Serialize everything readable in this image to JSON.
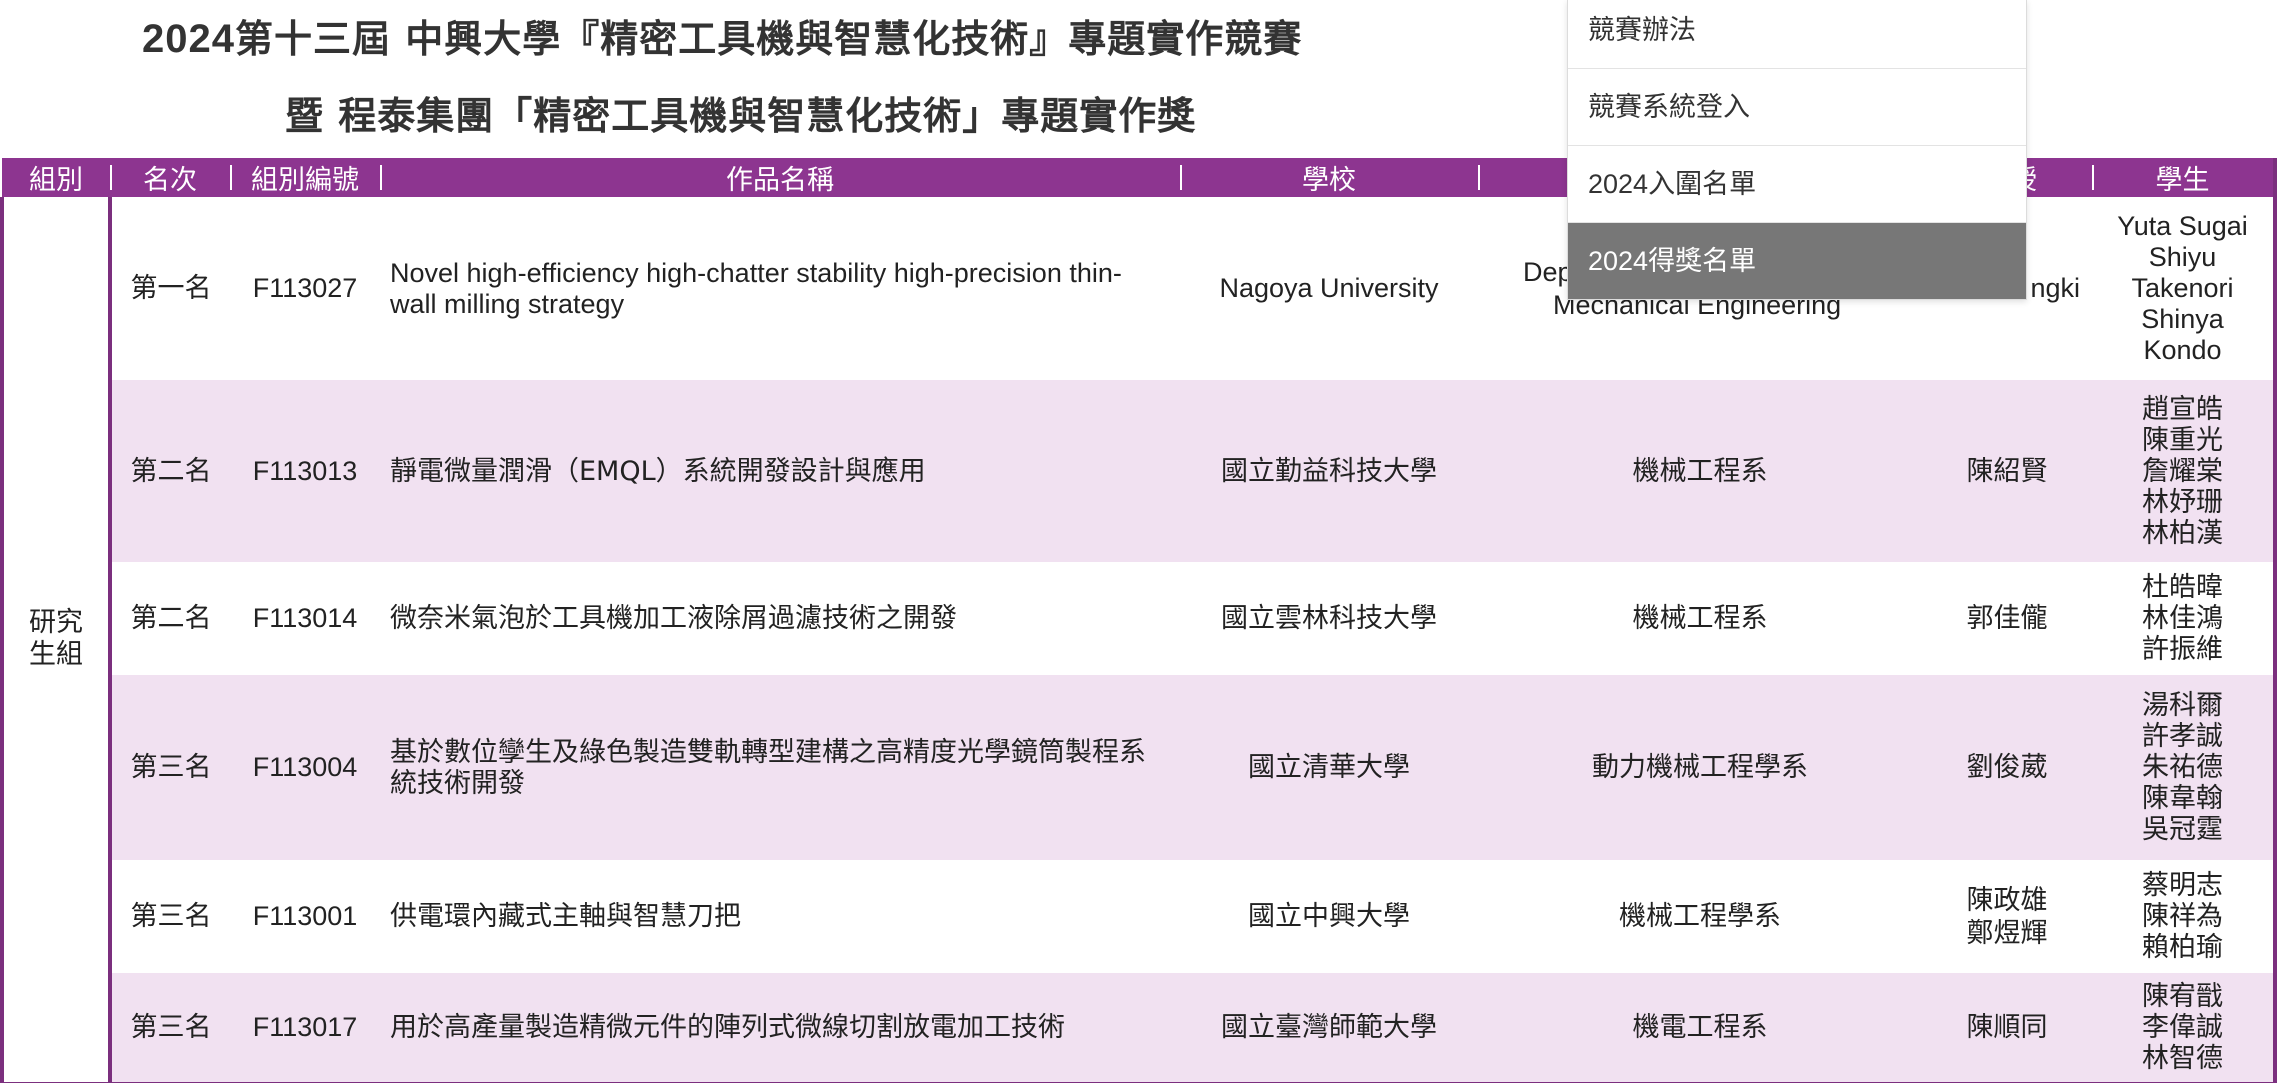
{
  "header": {
    "title_year": "2024",
    "title_line1": "第十三屆 中興大學『精密工具機與智慧化技術』專題實作競賽",
    "title_line2": "暨 程泰集團「精密工具機與智慧化技術」專題實作獎"
  },
  "dropdown": {
    "items": [
      {
        "label": "競賽辦法"
      },
      {
        "label": "競賽系統登入"
      },
      {
        "label": "2024入圍名單"
      },
      {
        "label": "2024得獎名單",
        "active": true
      }
    ]
  },
  "table": {
    "columns": [
      "組別",
      "名次",
      "組別編號",
      "作品名稱",
      "學校",
      "",
      "授",
      "學生"
    ],
    "group_label": "研究生組",
    "rows": [
      {
        "rank": "第一名",
        "code": "F113027",
        "title": "Novel high-efficiency high-chatter stability high-precision thin-wall milling strategy",
        "school": "Nagoya University",
        "department": "Mechanical Engineering",
        "department_partial": "Depar",
        "advisor": "ngki",
        "students": [
          "Yuta Sugai",
          "Shiyu",
          "Takenori",
          "Shinya",
          "Kondo"
        ]
      },
      {
        "rank": "第二名",
        "code": "F113013",
        "title": "靜電微量潤滑（EMQL）系統開發設計與應用",
        "school": "國立勤益科技大學",
        "department": "機械工程系",
        "advisor": "陳紹賢",
        "students": [
          "趙宣皓",
          "陳重光",
          "詹耀棠",
          "林妤珊",
          "林柏漢"
        ]
      },
      {
        "rank": "第二名",
        "code": "F113014",
        "title": "微奈米氣泡於工具機加工液除屑過濾技術之開發",
        "school": "國立雲林科技大學",
        "department": "機械工程系",
        "advisor": "郭佳儱",
        "students": [
          "杜皓暐",
          "林佳鴻",
          "許振維"
        ]
      },
      {
        "rank": "第三名",
        "code": "F113004",
        "title": "基於數位孿生及綠色製造雙軌轉型建構之高精度光學鏡筒製程系統技術開發",
        "school": "國立清華大學",
        "department": "動力機械工程學系",
        "advisor": "劉俊葳",
        "students": [
          "湯科爾",
          "許孝誠",
          "朱祐德",
          "陳韋翰",
          "吳冠霆"
        ]
      },
      {
        "rank": "第三名",
        "code": "F113001",
        "title": "供電環內藏式主軸與智慧刀把",
        "school": "國立中興大學",
        "department": "機械工程學系",
        "advisor": "陳政雄\n鄭煜輝",
        "students": [
          "蔡明志",
          "陳祥為",
          "賴柏瑜"
        ]
      },
      {
        "rank": "第三名",
        "code": "F113017",
        "title": "用於高產量製造精微元件的陣列式微線切割放電加工技術",
        "school": "國立臺灣師範大學",
        "department": "機電工程系",
        "advisor": "陳順同",
        "students": [
          "陳宥戩",
          "李偉誠",
          "林智德"
        ]
      }
    ]
  },
  "colors": {
    "header_purple": "#8d3590",
    "border_purple": "#7b2f7e",
    "row_alt_bg": "#f1e1f1",
    "menu_active_bg": "#777777"
  }
}
